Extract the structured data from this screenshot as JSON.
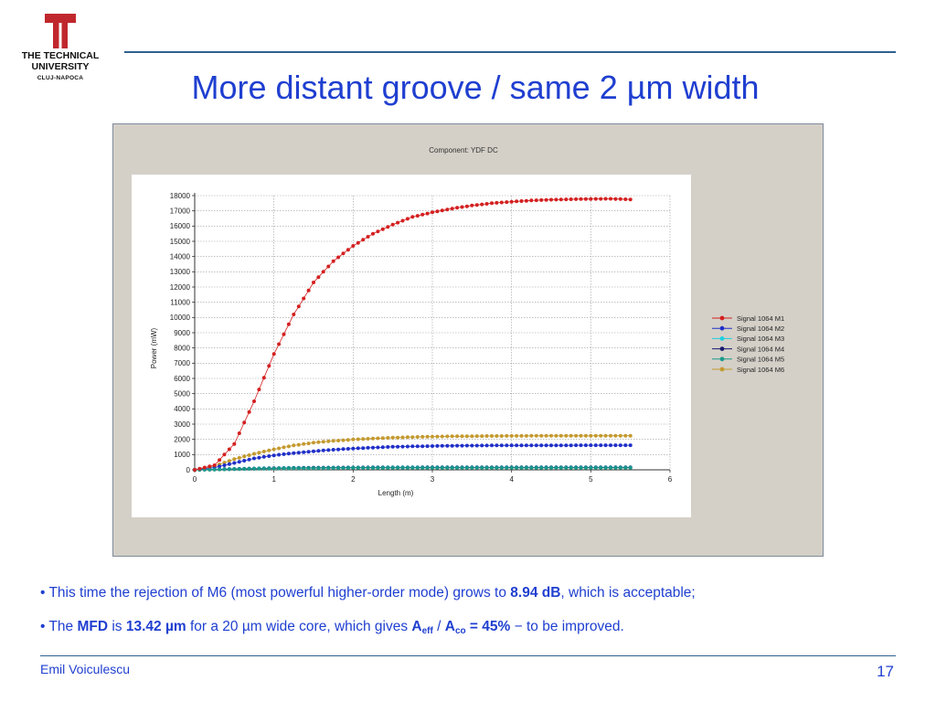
{
  "logo": {
    "line1": "THE TECHNICAL",
    "line2": "UNIVERSITY",
    "line3": "CLUJ-NAPOCA",
    "color": "#c0272d"
  },
  "slide": {
    "title": "More distant groove / same 2 µm width",
    "title_color": "#1f3fd0"
  },
  "bullets": [
    {
      "prefix": "• This time the rejection of M6 (most powerful higher-order mode) grows to ",
      "bold": "8.94 dB",
      "suffix": ", which is acceptable;"
    },
    {
      "t1": "• The ",
      "b1": "MFD",
      "t2": " is ",
      "b2": "13.42 µm",
      "t3": " for a 20 µm wide core, which gives  ",
      "a_letter": "A",
      "eff_sub": "eff",
      "slash": " / ",
      "co_sub": "co",
      "b3": " = 45%",
      "t4": " − to be improved."
    }
  ],
  "footer": {
    "author": "Emil Voiculescu",
    "page": "17"
  },
  "chart_data": {
    "type": "line",
    "title": "Component: YDF DC",
    "xlabel": "Length (m)",
    "ylabel": "Power (mW)",
    "xlim": [
      0,
      6
    ],
    "ylim": [
      0,
      18000
    ],
    "xticks": [
      0,
      1,
      2,
      3,
      4,
      5,
      6
    ],
    "yticks": [
      0,
      1000,
      2000,
      3000,
      4000,
      5000,
      6000,
      7000,
      8000,
      9000,
      10000,
      11000,
      12000,
      13000,
      14000,
      15000,
      16000,
      17000,
      18000
    ],
    "grid": true,
    "legend_position": "right",
    "x": [
      0,
      0.25,
      0.5,
      0.75,
      1,
      1.25,
      1.5,
      1.75,
      2,
      2.25,
      2.5,
      2.75,
      3,
      3.25,
      3.5,
      3.75,
      4,
      4.25,
      4.5,
      4.75,
      5,
      5.25,
      5.5
    ],
    "series": [
      {
        "name": "Signal 1064 M1",
        "color": "#d42020",
        "values": [
          0,
          300,
          1700,
          4500,
          7600,
          10200,
          12300,
          13700,
          14700,
          15500,
          16100,
          16600,
          16900,
          17150,
          17350,
          17500,
          17600,
          17680,
          17730,
          17760,
          17780,
          17790,
          17750
        ]
      },
      {
        "name": "Signal 1064 M2",
        "color": "#2030c8",
        "values": [
          0,
          150,
          450,
          750,
          950,
          1100,
          1220,
          1320,
          1400,
          1460,
          1510,
          1540,
          1560,
          1580,
          1590,
          1600,
          1600,
          1605,
          1610,
          1610,
          1615,
          1615,
          1615
        ]
      },
      {
        "name": "Signal 1064 M3",
        "color": "#1fd0e0",
        "values": [
          0,
          30,
          60,
          90,
          110,
          130,
          140,
          150,
          155,
          160,
          160,
          165,
          165,
          165,
          165,
          165,
          165,
          165,
          165,
          165,
          165,
          165,
          165
        ]
      },
      {
        "name": "Signal 1064 M4",
        "color": "#1a1a70",
        "values": [
          0,
          25,
          55,
          80,
          100,
          120,
          130,
          140,
          145,
          150,
          150,
          152,
          154,
          155,
          155,
          155,
          155,
          155,
          155,
          155,
          155,
          155,
          155
        ]
      },
      {
        "name": "Signal 1064 M5",
        "color": "#1a9a8a",
        "values": [
          0,
          20,
          45,
          65,
          85,
          100,
          110,
          118,
          124,
          128,
          130,
          132,
          133,
          134,
          135,
          135,
          135,
          135,
          135,
          135,
          135,
          135,
          135
        ]
      },
      {
        "name": "Signal 1064 M6",
        "color": "#c49a30",
        "values": [
          0,
          250,
          700,
          1050,
          1350,
          1600,
          1780,
          1900,
          1990,
          2060,
          2110,
          2150,
          2180,
          2200,
          2210,
          2220,
          2225,
          2230,
          2230,
          2235,
          2235,
          2240,
          2240
        ]
      }
    ]
  }
}
